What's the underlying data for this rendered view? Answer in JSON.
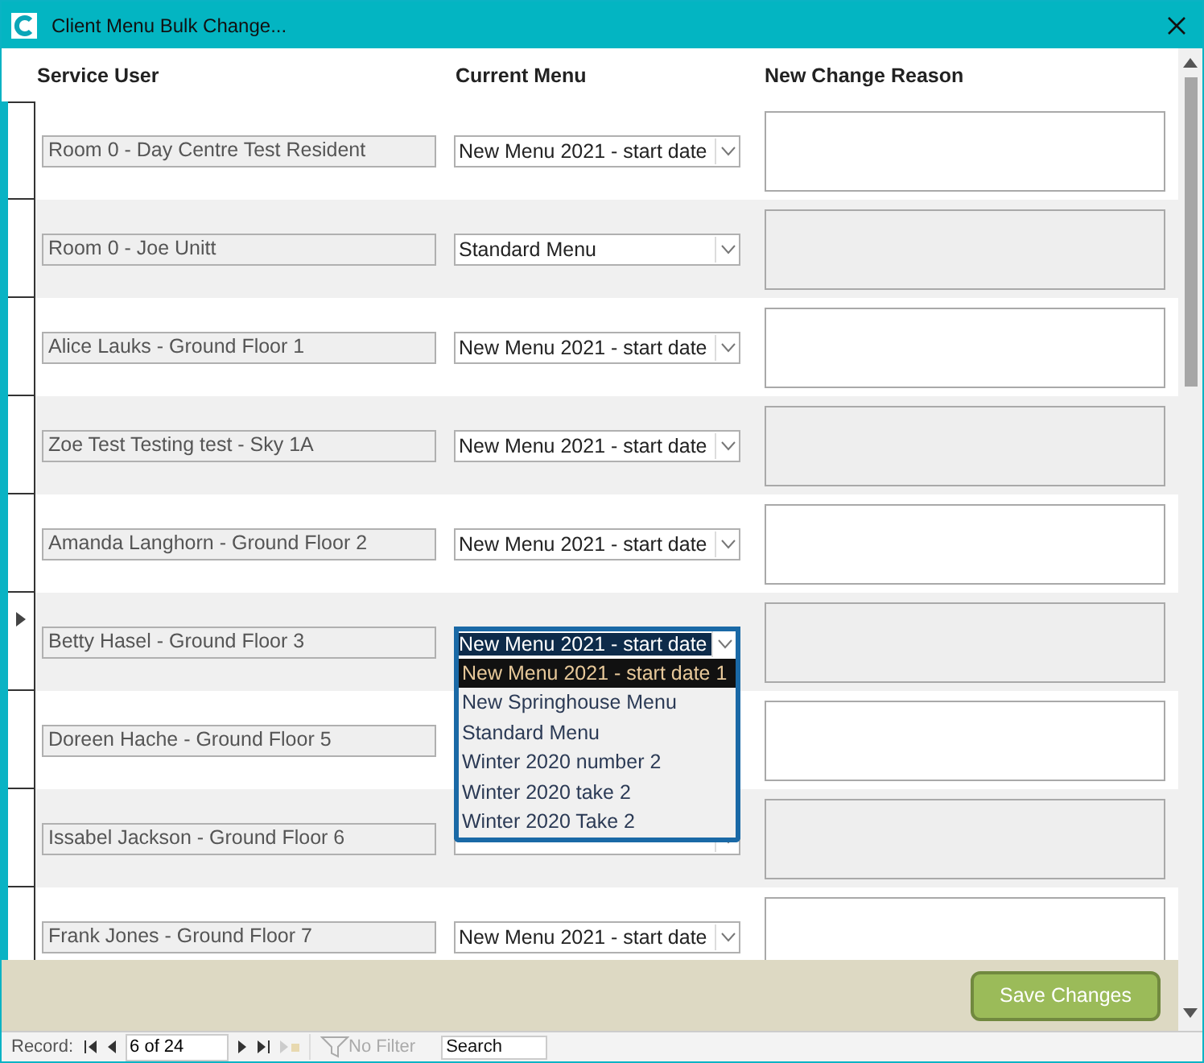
{
  "window": {
    "title": "Client Menu Bulk Change..."
  },
  "columns": [
    "Service User",
    "Current Menu",
    "New Change Reason"
  ],
  "rows": [
    {
      "service_user": "Room 0 - Day Centre Test Resident",
      "current_menu": "New Menu 2021 - start date",
      "selected": false
    },
    {
      "service_user": "Room 0 - Joe Unitt",
      "current_menu": "Standard Menu",
      "selected": false
    },
    {
      "service_user": "Alice Lauks - Ground Floor 1",
      "current_menu": "New Menu 2021 - start date",
      "selected": false
    },
    {
      "service_user": "Zoe Test Testing test - Sky 1A",
      "current_menu": "New Menu 2021 - start date",
      "selected": false
    },
    {
      "service_user": "Amanda Langhorn - Ground Floor 2",
      "current_menu": "New Menu 2021 - start date",
      "selected": false
    },
    {
      "service_user": "Betty Hasel - Ground Floor 3",
      "current_menu": "New Menu 2021 - start date",
      "selected": true
    },
    {
      "service_user": "Doreen Hache - Ground Floor 5",
      "selected": false
    },
    {
      "service_user": "Issabel Jackson - Ground Floor 6",
      "selected": false
    },
    {
      "service_user": "Frank Jones - Ground Floor 7",
      "current_menu": "New Menu 2021 - start date",
      "selected": false
    }
  ],
  "dropdown": {
    "options": [
      {
        "label": "New Menu 2021 - start date 1",
        "selected": true
      },
      {
        "label": "New Springhouse Menu",
        "selected": false
      },
      {
        "label": "Standard Menu",
        "selected": false
      },
      {
        "label": "Winter 2020 number 2",
        "selected": false
      },
      {
        "label": "Winter 2020 take 2",
        "selected": false
      },
      {
        "label": "Winter 2020 Take 2",
        "selected": false
      }
    ]
  },
  "save_button": "Save Changes",
  "navigation": {
    "label": "Record:",
    "position": "6 of 24",
    "filter": "No Filter",
    "search": {
      "placeholder": "Search"
    }
  }
}
